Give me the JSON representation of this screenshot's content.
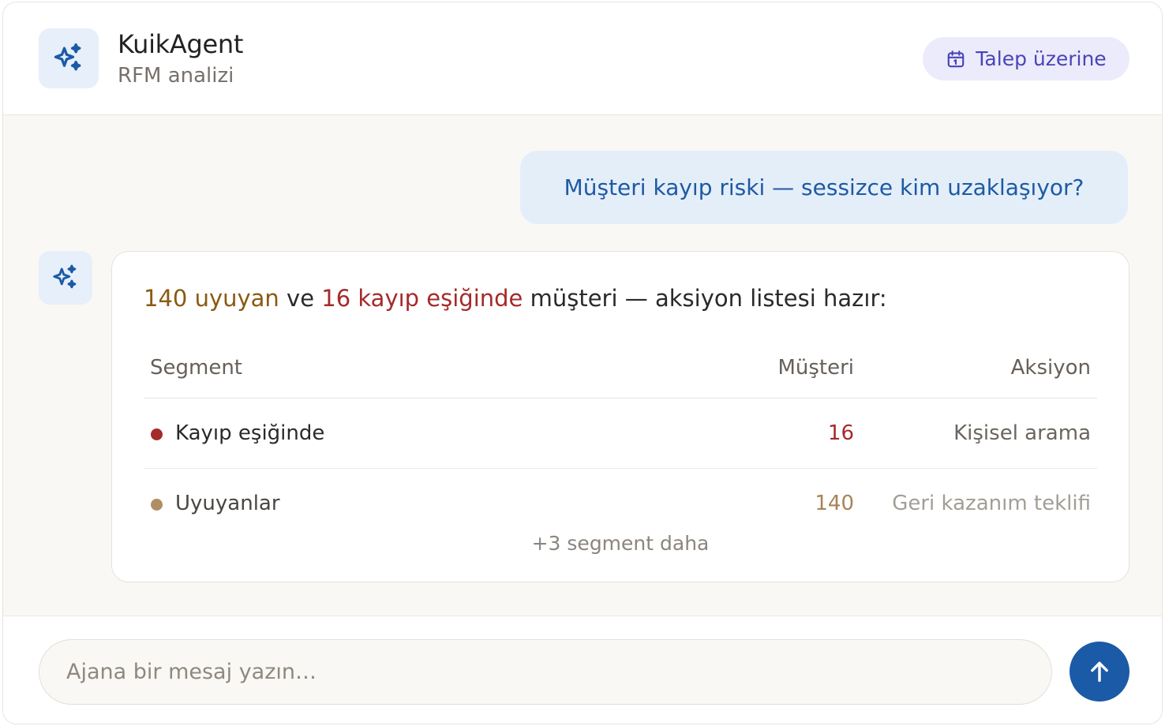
{
  "header": {
    "title": "KuikAgent",
    "subtitle": "RFM analizi",
    "mode_label": "Talep üzerine"
  },
  "icons": {
    "logo": "sparkles-icon",
    "mode": "calendar-icon",
    "send": "arrow-up-icon"
  },
  "colors": {
    "accent": "#1b5aa6",
    "dormant": "#8a5a12",
    "at_risk": "#a52a2a",
    "dormant_dot": "#b08d62",
    "at_risk_dot": "#a52a2a"
  },
  "conversation": {
    "user_message": "Müşteri kayıp riski — sessizce kim uzaklaşıyor?",
    "agent": {
      "summary": {
        "dormant_highlight": "140 uyuyan",
        "connector": " ve ",
        "atrisk_highlight": "16 kayıp eşiğinde",
        "rest": " müşteri — aksiyon listesi hazır:"
      },
      "table": {
        "headers": [
          "Segment",
          "Müşteri",
          "Aksiyon"
        ],
        "rows": [
          {
            "segment": "Kayıp eşiğinde",
            "count": "16",
            "action": "Kişisel arama"
          },
          {
            "segment": "Uyuyanlar",
            "count": "140",
            "action": "Geri kazanım teklifi"
          }
        ],
        "more_label": "+3 segment daha"
      }
    }
  },
  "composer": {
    "placeholder": "Ajana bir mesaj yazın…",
    "value": ""
  }
}
